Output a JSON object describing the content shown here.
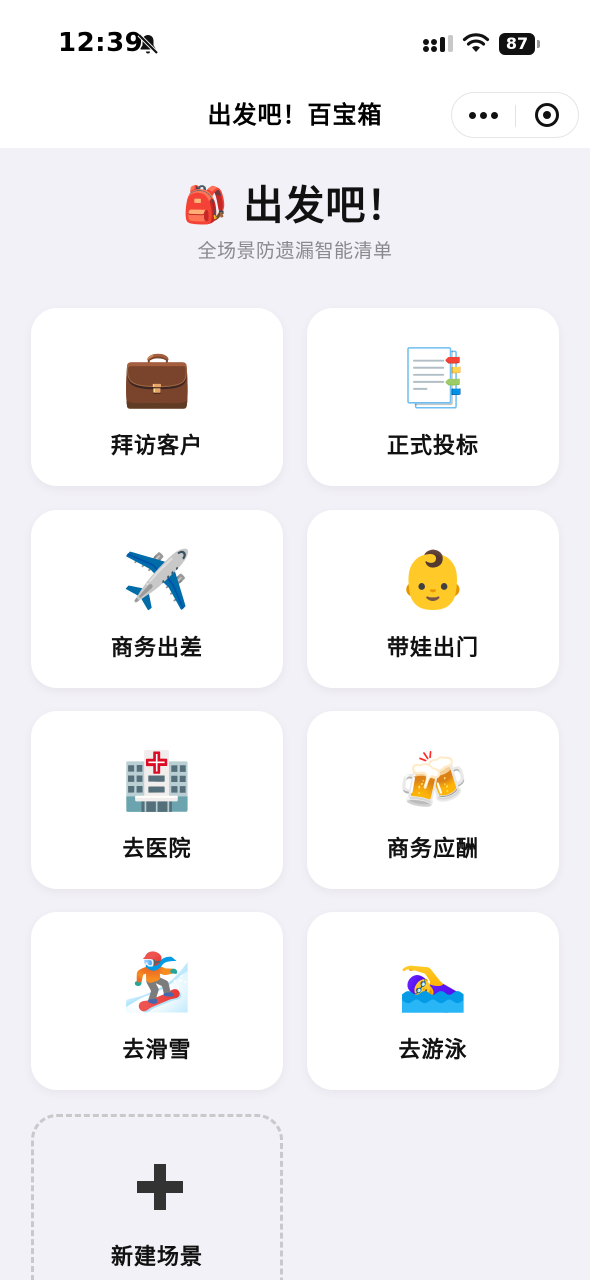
{
  "status_bar": {
    "time": "12:39",
    "battery": "87",
    "icons": [
      "bell-off-icon",
      "signal-icon",
      "wifi-icon",
      "battery-icon"
    ]
  },
  "nav": {
    "title": "出发吧！百宝箱",
    "more_icon": "more-dots-icon",
    "close_icon": "target-close-icon"
  },
  "hero": {
    "emoji": "🎒",
    "title": "出发吧！",
    "subtitle": "全场景防遗漏智能清单"
  },
  "scenes": [
    {
      "emoji": "💼",
      "label": "拜访客户"
    },
    {
      "emoji": "📑",
      "label": "正式投标"
    },
    {
      "emoji": "✈️",
      "label": "商务出差"
    },
    {
      "emoji": "👶",
      "label": "带娃出门"
    },
    {
      "emoji": "🏥",
      "label": "去医院"
    },
    {
      "emoji": "🍻",
      "label": "商务应酬"
    },
    {
      "emoji": "🏂",
      "label": "去滑雪"
    },
    {
      "emoji": "🏊‍♀️",
      "label": "去游泳"
    }
  ],
  "add_scene": {
    "icon": "plus-icon",
    "label": "新建场景"
  },
  "colors": {
    "background": "#f2f1f7",
    "card": "#ffffff",
    "text": "#111111",
    "subtitle": "#8a8a8e"
  }
}
